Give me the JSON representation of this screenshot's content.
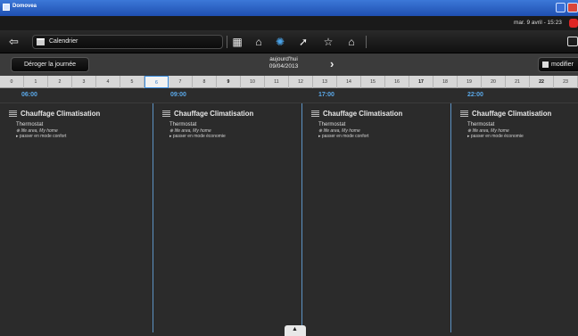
{
  "window": {
    "title": "Domovea"
  },
  "status": {
    "datetime": "mar. 9 avril - 15:23"
  },
  "toolbar": {
    "breadcrumb": "Calendrier",
    "icons": [
      "calendar-icon",
      "house-icon",
      "automation-icon",
      "surveillance-icon",
      "favorite-star-icon",
      "alarm-bell-icon"
    ]
  },
  "subbar": {
    "deroger_label": "Déroger la journée",
    "today_line1": "aujourd'hui",
    "today_line2": "09/04/2013",
    "next_symbol": "›",
    "modifier_label": "modifier"
  },
  "ruler": {
    "hours": [
      "0",
      "1",
      "2",
      "3",
      "4",
      "5",
      "6",
      "7",
      "8",
      "9",
      "10",
      "11",
      "12",
      "13",
      "14",
      "15",
      "16",
      "17",
      "18",
      "19",
      "20",
      "21",
      "22",
      "23"
    ],
    "bold_hours": [
      "9",
      "17",
      "22"
    ],
    "selected_hour": "6"
  },
  "slots": [
    {
      "time": "06:00",
      "title": "Chauffage Climatisation",
      "device": "Thermostat",
      "area": "life area, My home",
      "action": "passer en mode confort"
    },
    {
      "time": "09:00",
      "title": "Chauffage Climatisation",
      "device": "Thermostat",
      "area": "life area, My home",
      "action": "passer en mode économie"
    },
    {
      "time": "17:00",
      "title": "Chauffage Climatisation",
      "device": "Thermostat",
      "area": "life area, My home",
      "action": "passer en mode confort"
    },
    {
      "time": "22:00",
      "title": "Chauffage Climatisation",
      "device": "Thermostat",
      "area": "life area, My home",
      "action": "passer en mode économie"
    }
  ],
  "colors": {
    "accent": "#5aa8e8",
    "selection": "#3a8de0",
    "record": "#e02525"
  }
}
